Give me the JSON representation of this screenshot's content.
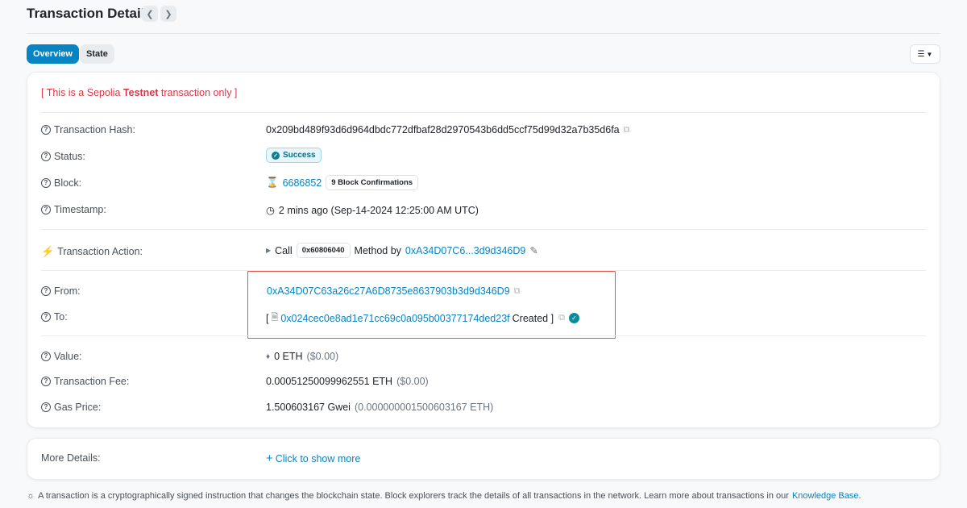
{
  "header": {
    "title": "Transaction Details"
  },
  "tabs": [
    {
      "label": "Overview",
      "active": true
    },
    {
      "label": "State",
      "active": false
    }
  ],
  "warning": {
    "prefix": "[ This is a Sepolia ",
    "bold": "Testnet",
    "suffix": " transaction only ]"
  },
  "fields": {
    "hash": {
      "label": "Transaction Hash:",
      "value": "0x209bd489f93d6d964dbdc772dfbaf28d2970543b6dd5ccf75d99d32a7b35d6fa"
    },
    "status": {
      "label": "Status:",
      "value": "Success"
    },
    "block": {
      "label": "Block:",
      "value": "6686852",
      "confirmations": "9 Block Confirmations"
    },
    "timestamp": {
      "label": "Timestamp:",
      "value": "2 mins ago (Sep-14-2024 12:25:00 AM UTC)"
    },
    "action": {
      "label": "Transaction Action:",
      "call": "Call",
      "method_id": "0x60806040",
      "method_by": "Method by",
      "address": "0xA34D07C6...3d9d346D9"
    },
    "from": {
      "label": "From:",
      "value": "0xA34D07C63a26c27A6D8735e8637903b3d9d346D9"
    },
    "to": {
      "label": "To:",
      "open": "[",
      "value": "0x024cec0e8ad1e71cc69c0a095b00377174ded23f",
      "created": "Created ]"
    },
    "value": {
      "label": "Value:",
      "amount": "0 ETH",
      "usd": "($0.00)"
    },
    "fee": {
      "label": "Transaction Fee:",
      "amount": "0.00051250099962551 ETH",
      "usd": "($0.00)"
    },
    "gas": {
      "label": "Gas Price:",
      "amount": "1.500603167 Gwei",
      "eth": "(0.000000001500603167 ETH)"
    }
  },
  "more": {
    "label": "More Details:",
    "link": "Click to show more"
  },
  "footer": {
    "text": "A transaction is a cryptographically signed instruction that changes the blockchain state. Block explorers track the details of all transactions in the network. Learn more about transactions in our",
    "link": "Knowledge Base",
    "end": "."
  },
  "colors": {
    "accent": "#0784c3",
    "warning": "#dc3545",
    "success": "#0a7c96",
    "highlight": "#e8584a"
  },
  "icons": [
    "question-icon",
    "copy-icon",
    "hourglass-icon",
    "clock-icon",
    "lightning-icon",
    "edit-icon",
    "eth-icon",
    "lightbulb-icon",
    "contract-icon",
    "check-icon"
  ]
}
